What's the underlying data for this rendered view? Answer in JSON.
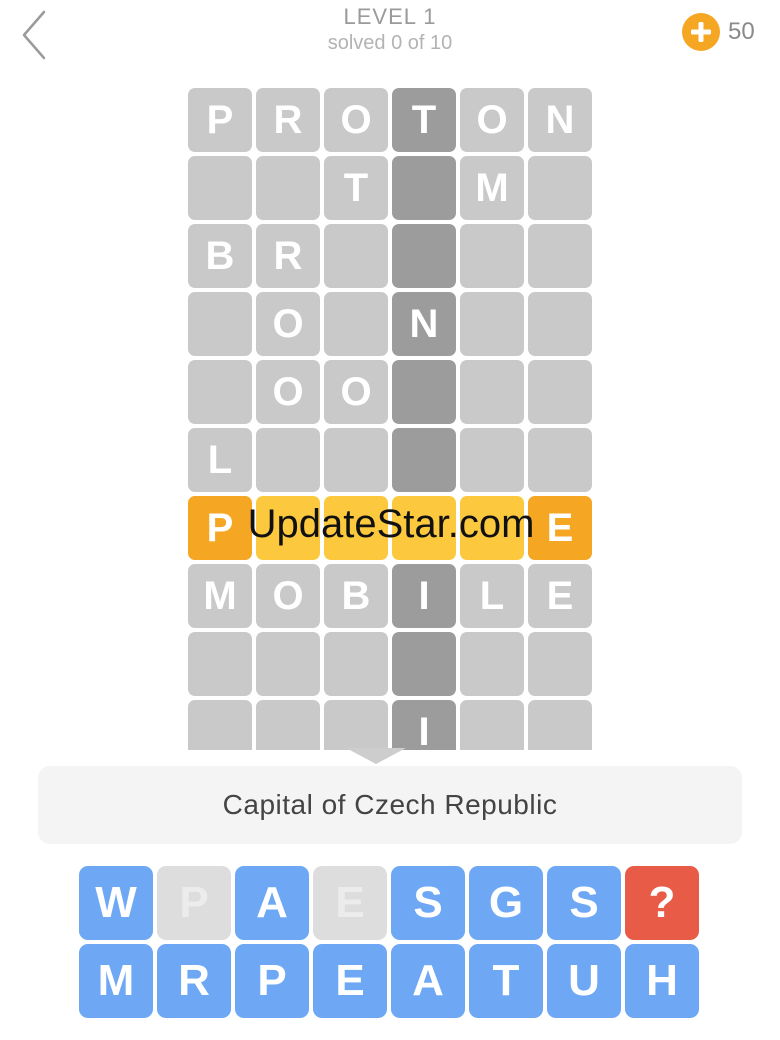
{
  "header": {
    "level_title": "LEVEL 1",
    "level_subtitle": "solved 0 of 10",
    "coins": "50"
  },
  "icons": {
    "back": "chevron-left-icon",
    "coin": "plus-coin-icon"
  },
  "colors": {
    "tile": "#c9c9c9",
    "tile_column": "#9c9c9c",
    "tile_active_end": "#f5a623",
    "tile_active": "#fcc93e",
    "key": "#6ea8f5",
    "key_used": "#dddddd",
    "key_hint": "#e85c47"
  },
  "grid": {
    "rows": [
      {
        "state": "normal",
        "cells": [
          "P",
          "R",
          "O",
          "T",
          "O",
          "N"
        ]
      },
      {
        "state": "normal",
        "cells": [
          "",
          "",
          "T",
          "",
          "M",
          ""
        ]
      },
      {
        "state": "normal",
        "cells": [
          "B",
          "R",
          "",
          "",
          "",
          ""
        ]
      },
      {
        "state": "normal",
        "cells": [
          "",
          "O",
          "",
          "N",
          "",
          ""
        ]
      },
      {
        "state": "normal",
        "cells": [
          "",
          "O",
          "O",
          "",
          "",
          ""
        ]
      },
      {
        "state": "normal",
        "cells": [
          "L",
          "",
          "",
          "",
          "",
          ""
        ]
      },
      {
        "state": "active",
        "cells": [
          "P",
          "",
          "",
          "",
          "",
          "E"
        ]
      },
      {
        "state": "normal",
        "cells": [
          "M",
          "O",
          "B",
          "I",
          "L",
          "E"
        ]
      },
      {
        "state": "normal",
        "cells": [
          "",
          "",
          "",
          "",
          "",
          ""
        ]
      },
      {
        "state": "normal",
        "cells": [
          "",
          "",
          "",
          "I",
          "",
          ""
        ]
      }
    ],
    "highlight_column": 3
  },
  "watermark": "UpdateStar.com",
  "clue": "Capital of Czech Republic",
  "keyboard": {
    "rows": [
      [
        {
          "l": "W",
          "s": "normal"
        },
        {
          "l": "P",
          "s": "used"
        },
        {
          "l": "A",
          "s": "normal"
        },
        {
          "l": "E",
          "s": "used"
        },
        {
          "l": "S",
          "s": "normal"
        },
        {
          "l": "G",
          "s": "normal"
        },
        {
          "l": "S",
          "s": "normal"
        },
        {
          "l": "?",
          "s": "hint"
        }
      ],
      [
        {
          "l": "M",
          "s": "normal"
        },
        {
          "l": "R",
          "s": "normal"
        },
        {
          "l": "P",
          "s": "normal"
        },
        {
          "l": "E",
          "s": "normal"
        },
        {
          "l": "A",
          "s": "normal"
        },
        {
          "l": "T",
          "s": "normal"
        },
        {
          "l": "U",
          "s": "normal"
        },
        {
          "l": "H",
          "s": "normal"
        }
      ]
    ]
  }
}
